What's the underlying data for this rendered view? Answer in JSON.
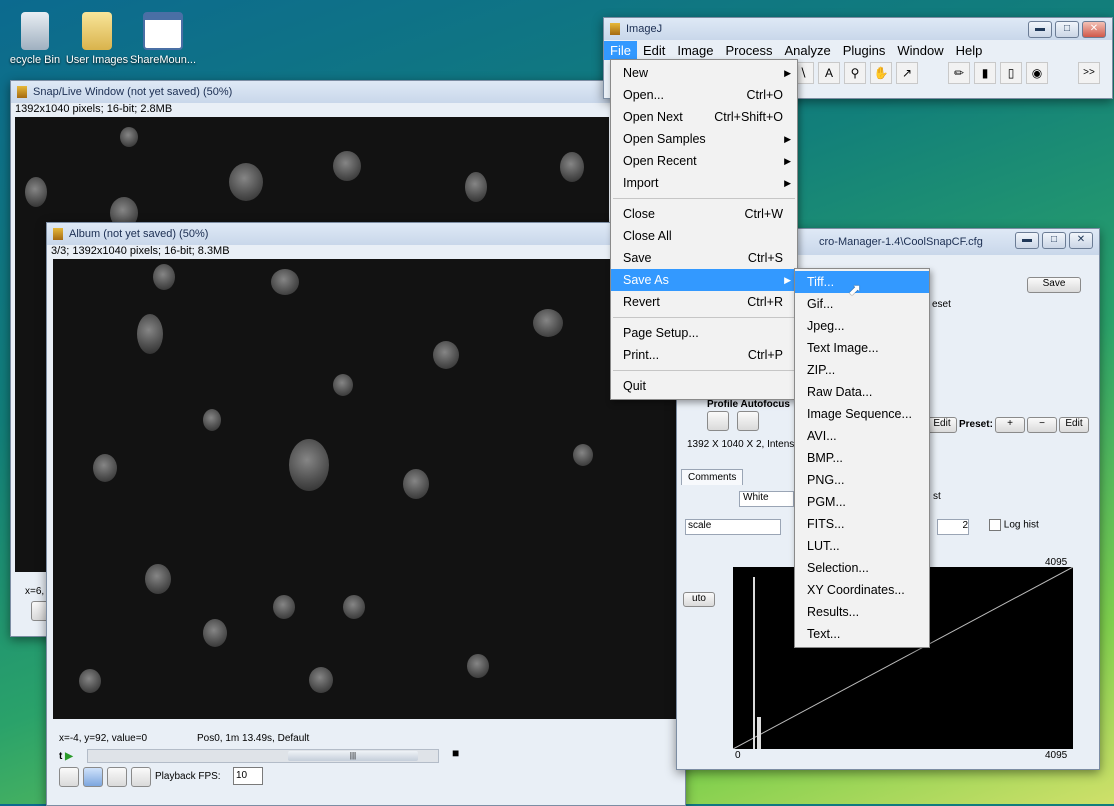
{
  "desktop": {
    "icons": [
      "ecycle Bin",
      "User Images",
      "ShareMoun..."
    ]
  },
  "snap_window": {
    "title": "Snap/Live Window (not yet saved) (50%)",
    "info": "1392x1040 pixels; 16-bit; 2.8MB",
    "status_fragment": "x=6,"
  },
  "album_window": {
    "title": "Album (not yet saved) (50%)",
    "info": "3/3; 1392x1040 pixels; 16-bit; 8.3MB",
    "status_coords": "x=-4, y=92, value=0",
    "status_pos": "Pos0, 1m 13.49s, Default",
    "t_label": "t",
    "playback_label": "Playback FPS:",
    "fps_value": "10"
  },
  "imagej": {
    "title": "ImageJ",
    "menus": [
      "File",
      "Edit",
      "Image",
      "Process",
      "Analyze",
      "Plugins",
      "Window",
      "Help"
    ],
    "more": ">>"
  },
  "file_menu": {
    "items": [
      {
        "label": "New",
        "shortcut": "",
        "submenu": true
      },
      {
        "label": "Open...",
        "shortcut": "Ctrl+O",
        "submenu": false
      },
      {
        "label": "Open Next",
        "shortcut": "Ctrl+Shift+O",
        "submenu": false
      },
      {
        "label": "Open Samples",
        "shortcut": "",
        "submenu": true
      },
      {
        "label": "Open Recent",
        "shortcut": "",
        "submenu": true
      },
      {
        "label": "Import",
        "shortcut": "",
        "submenu": true
      },
      {
        "label": "Close",
        "shortcut": "Ctrl+W",
        "submenu": false
      },
      {
        "label": "Close All",
        "shortcut": "",
        "submenu": false
      },
      {
        "label": "Save",
        "shortcut": "Ctrl+S",
        "submenu": false
      },
      {
        "label": "Save As",
        "shortcut": "",
        "submenu": true
      },
      {
        "label": "Revert",
        "shortcut": "Ctrl+R",
        "submenu": false
      },
      {
        "label": "Page Setup...",
        "shortcut": "",
        "submenu": false
      },
      {
        "label": "Print...",
        "shortcut": "Ctrl+P",
        "submenu": false
      },
      {
        "label": "Quit",
        "shortcut": "",
        "submenu": false
      }
    ]
  },
  "saveas_menu": {
    "items": [
      "Tiff...",
      "Gif...",
      "Jpeg...",
      "Text Image...",
      "ZIP...",
      "Raw Data...",
      "Image Sequence...",
      "AVI...",
      "BMP...",
      "PNG...",
      "PGM...",
      "FITS...",
      "LUT...",
      "Selection...",
      "XY Coordinates...",
      "Results...",
      "Text..."
    ]
  },
  "micromanager": {
    "title": "cro-Manager-1.4\\CoolSnapCF.cfg",
    "save_btn": "Save",
    "reset_fragment": "eset",
    "profile_autofocus": "Profile  Autofocus",
    "edit1": "Edit",
    "preset_label": "Preset:",
    "plus": "+",
    "minus": "−",
    "edit2": "Edit",
    "image_info": "1392 X 1040 X 2, Intensit",
    "comments_tab": "Comments",
    "white_label": "White",
    "st_fragment": "st",
    "scale_fragment": "scale",
    "spin_value": "2",
    "log_hist": "Log hist",
    "auto_fragment": "uto",
    "hist_max_top": "4095",
    "hist_min": "0",
    "hist_max_bottom": "4095"
  }
}
